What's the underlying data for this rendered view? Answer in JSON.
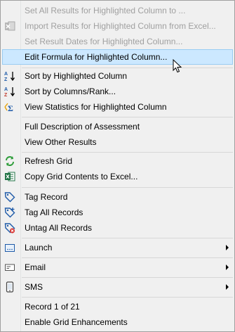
{
  "menu": {
    "items": [
      {
        "label": "Set All Results for Highlighted Column to ..."
      },
      {
        "label": "Import Results for Highlighted Column from Excel..."
      },
      {
        "label": "Set Result Dates for Highlighted Column..."
      },
      {
        "label": "Edit Formula for Highlighted Column..."
      },
      {
        "label": "Sort by Highlighted Column"
      },
      {
        "label": "Sort by Columns/Rank..."
      },
      {
        "label": "View Statistics for Highlighted Column"
      },
      {
        "label": "Full Description of Assessment"
      },
      {
        "label": "View Other Results"
      },
      {
        "label": "Refresh Grid"
      },
      {
        "label": "Copy Grid Contents to Excel..."
      },
      {
        "label": "Tag Record"
      },
      {
        "label": "Tag All Records"
      },
      {
        "label": "Untag All Records"
      },
      {
        "label": "Launch"
      },
      {
        "label": "Email"
      },
      {
        "label": "SMS"
      },
      {
        "label": "Record 1 of 21"
      },
      {
        "label": "Enable Grid Enhancements"
      }
    ]
  },
  "colors": {
    "highlight_bg": "#cce8ff",
    "highlight_border": "#99ccf2",
    "disabled_text": "#a0a0a0",
    "menu_bg": "#f0f0f0"
  }
}
